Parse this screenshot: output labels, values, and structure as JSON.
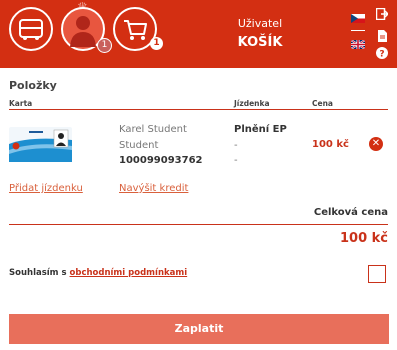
{
  "header": {
    "user_label": "Uživatel",
    "page_title": "KOŠÍK",
    "profile_badge": "1",
    "cart_badge": "1",
    "languages": [
      "czech-flag",
      "uk-flag"
    ]
  },
  "items": {
    "title": "Položky",
    "col_card": "Karta",
    "col_ticket": "Jízdenka",
    "col_price": "Cena",
    "row": {
      "holder_name": "Karel Student",
      "holder_type": "Student",
      "card_number": "100099093762",
      "ticket_name": "Plnění EP",
      "ticket_detail_1": "-",
      "ticket_detail_2": "-",
      "price": "100 kč"
    },
    "add_ticket_link": "Přidat jízdenku",
    "add_credit_link": "Navýšit kredit"
  },
  "totals": {
    "label": "Celková cena",
    "value": "100 kč"
  },
  "agreement": {
    "text": "Souhlasím s",
    "link": "obchodními podmínkami",
    "checked": false
  },
  "pay_button": "Zaplatit",
  "colors": {
    "brand_red": "#d32f12",
    "button": "#e86f5b"
  }
}
